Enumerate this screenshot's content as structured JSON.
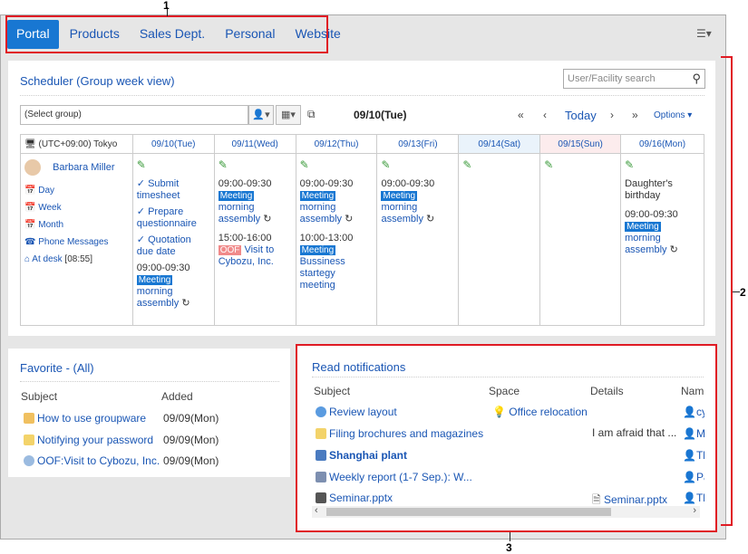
{
  "tabs": [
    "Portal",
    "Products",
    "Sales Dept.",
    "Personal",
    "Website"
  ],
  "annotations": [
    "1",
    "2",
    "3"
  ],
  "scheduler": {
    "title": "Scheduler (Group week view)",
    "search_placeholder": "User/Facility search",
    "group_select": "(Select group)",
    "current_date": "09/10(Tue)",
    "today_label": "Today",
    "options_label": "Options",
    "timezone": "(UTC+09:00) Tokyo",
    "days": [
      "09/10(Tue)",
      "09/11(Wed)",
      "09/12(Thu)",
      "09/13(Fri)",
      "09/14(Sat)",
      "09/15(Sun)",
      "09/16(Mon)"
    ],
    "user_name": "Barbara Miller",
    "user_links": [
      "Day",
      "Week",
      "Month",
      "Phone Messages",
      "At desk"
    ],
    "at_desk_time": "[08:55]",
    "todos": [
      "Submit timesheet",
      "Prepare questionnaire",
      "Quotation due date"
    ],
    "meeting_badge": "Meeting",
    "oof_badge": "OOF",
    "morning_assembly": "morning assembly",
    "time_0930": "09:00-09:30",
    "wed_visit_time": "15:00-16:00",
    "wed_visit_title": "Visit to Cybozu, Inc.",
    "thu_meeting_time": "10:00-13:00",
    "thu_meeting_title": "Bussiness startegy meeting",
    "mon_birthday": "Daughter's birthday"
  },
  "favorite": {
    "title": "Favorite - (All)",
    "col_subject": "Subject",
    "col_added": "Added",
    "rows": [
      {
        "subject": "How to use groupware",
        "added": "09/09(Mon)"
      },
      {
        "subject": "Notifying your password",
        "added": "09/09(Mon)"
      },
      {
        "subject": "OOF:Visit to Cybozu, Inc.",
        "added": "09/09(Mon)"
      }
    ]
  },
  "notifications": {
    "title": "Read notifications",
    "cols": [
      "Subject",
      "Space",
      "Details",
      "Name"
    ],
    "rows": [
      {
        "subject": "Review layout",
        "space": "Office relocation",
        "details": "",
        "name": "cy"
      },
      {
        "subject": "Filing brochures and magazines",
        "space": "",
        "details": "I am afraid that ...",
        "name": "M"
      },
      {
        "subject": "Shanghai plant",
        "space": "",
        "details": "",
        "name": "Tl"
      },
      {
        "subject": "Weekly report (1-7 Sep.): W...",
        "space": "",
        "details": "",
        "name": "Pa"
      },
      {
        "subject": "Seminar.pptx",
        "space": "",
        "details": "Seminar.pptx",
        "name": "Tl"
      }
    ]
  },
  "colors": {
    "accent": "#1877d2",
    "annotation": "#e01b24",
    "link": "#1a56b4"
  }
}
